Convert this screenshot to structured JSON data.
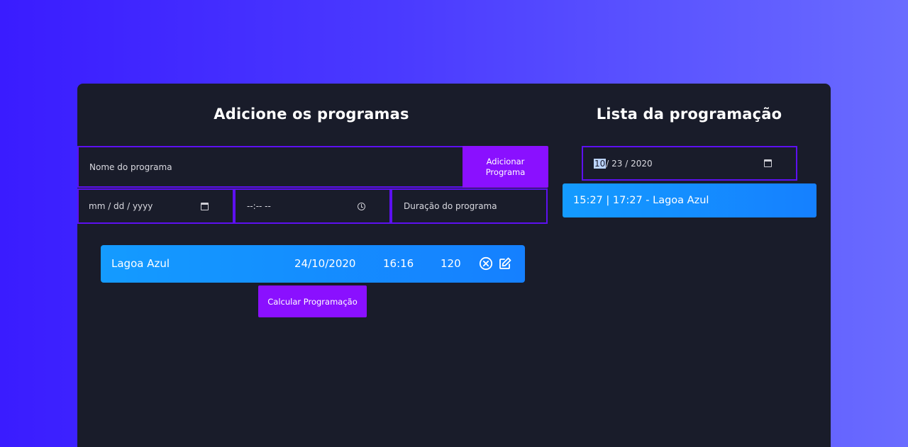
{
  "left_panel": {
    "title": "Adicione os programas",
    "name_placeholder": "Nome do programa",
    "add_button": "Adicionar Programa",
    "date_placeholder": "mm / dd / yyyy",
    "time_placeholder": "--:-- --",
    "duration_placeholder": "Duração do programa",
    "programs": [
      {
        "name": "Lagoa Azul",
        "date": "24/10/2020",
        "time": "16:16",
        "duration": "120"
      }
    ],
    "calc_button": "Calcular Programação"
  },
  "right_panel": {
    "title": "Lista da programação",
    "date_month": "10",
    "date_rest": "/ 23 / 2020",
    "schedule": [
      {
        "text": "15:27 | 17:27 - Lagoa Azul"
      }
    ]
  },
  "icons": {
    "calendar": "calendar-icon",
    "clock": "clock-icon",
    "remove": "close-circle-icon",
    "edit": "edit-icon"
  },
  "colors": {
    "accent": "#8a10ff",
    "border": "#5d10f0",
    "card": "#191c2a",
    "item": "#1580ff"
  }
}
